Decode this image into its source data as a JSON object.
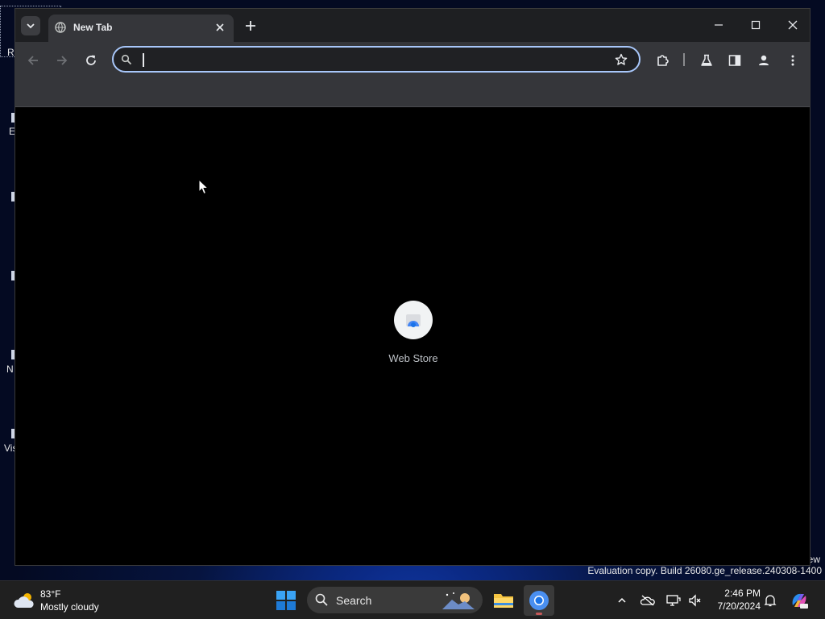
{
  "desktop": {
    "icon_labels": [
      "R",
      "E",
      "N",
      "Vis"
    ],
    "watermark": "Evaluation copy. Build 26080.ge_release.240308-1400",
    "watermark_partial": "ew"
  },
  "browser": {
    "tab": {
      "title": "New Tab",
      "favicon": "globe-icon"
    },
    "window_controls": {
      "minimize": "minimize-icon",
      "maximize": "maximize-icon",
      "close": "close-icon"
    },
    "toolbar": {
      "back": "back-arrow-icon",
      "forward": "forward-arrow-icon",
      "reload": "reload-icon",
      "omnibox_value": "",
      "omnibox_placeholder": "",
      "bookmark": "star-icon",
      "extensions": "puzzle-icon",
      "labs": "flask-icon",
      "side_panel": "side-panel-icon",
      "profile": "person-icon",
      "menu": "kebab-menu-icon"
    },
    "shortcuts": [
      {
        "label": "Web Store",
        "icon": "web-store-icon"
      }
    ],
    "colors": {
      "frame": "#1e1f22",
      "toolbar": "#35363a",
      "omnibox_focus": "#a8c7fa"
    }
  },
  "taskbar": {
    "weather": {
      "temperature": "83°F",
      "condition": "Mostly cloudy",
      "icon": "cloud-sun-icon"
    },
    "search_label": "Search",
    "pinned": [
      "windows-start-icon",
      "file-explorer-icon",
      "chrome-icon"
    ],
    "tray_icons": [
      "chevron-up-icon",
      "onedrive-offline-icon",
      "display-icon",
      "volume-muted-icon",
      "bell-icon",
      "copilot-icon"
    ],
    "clock": {
      "time": "2:46 PM",
      "date": "7/20/2024"
    }
  }
}
